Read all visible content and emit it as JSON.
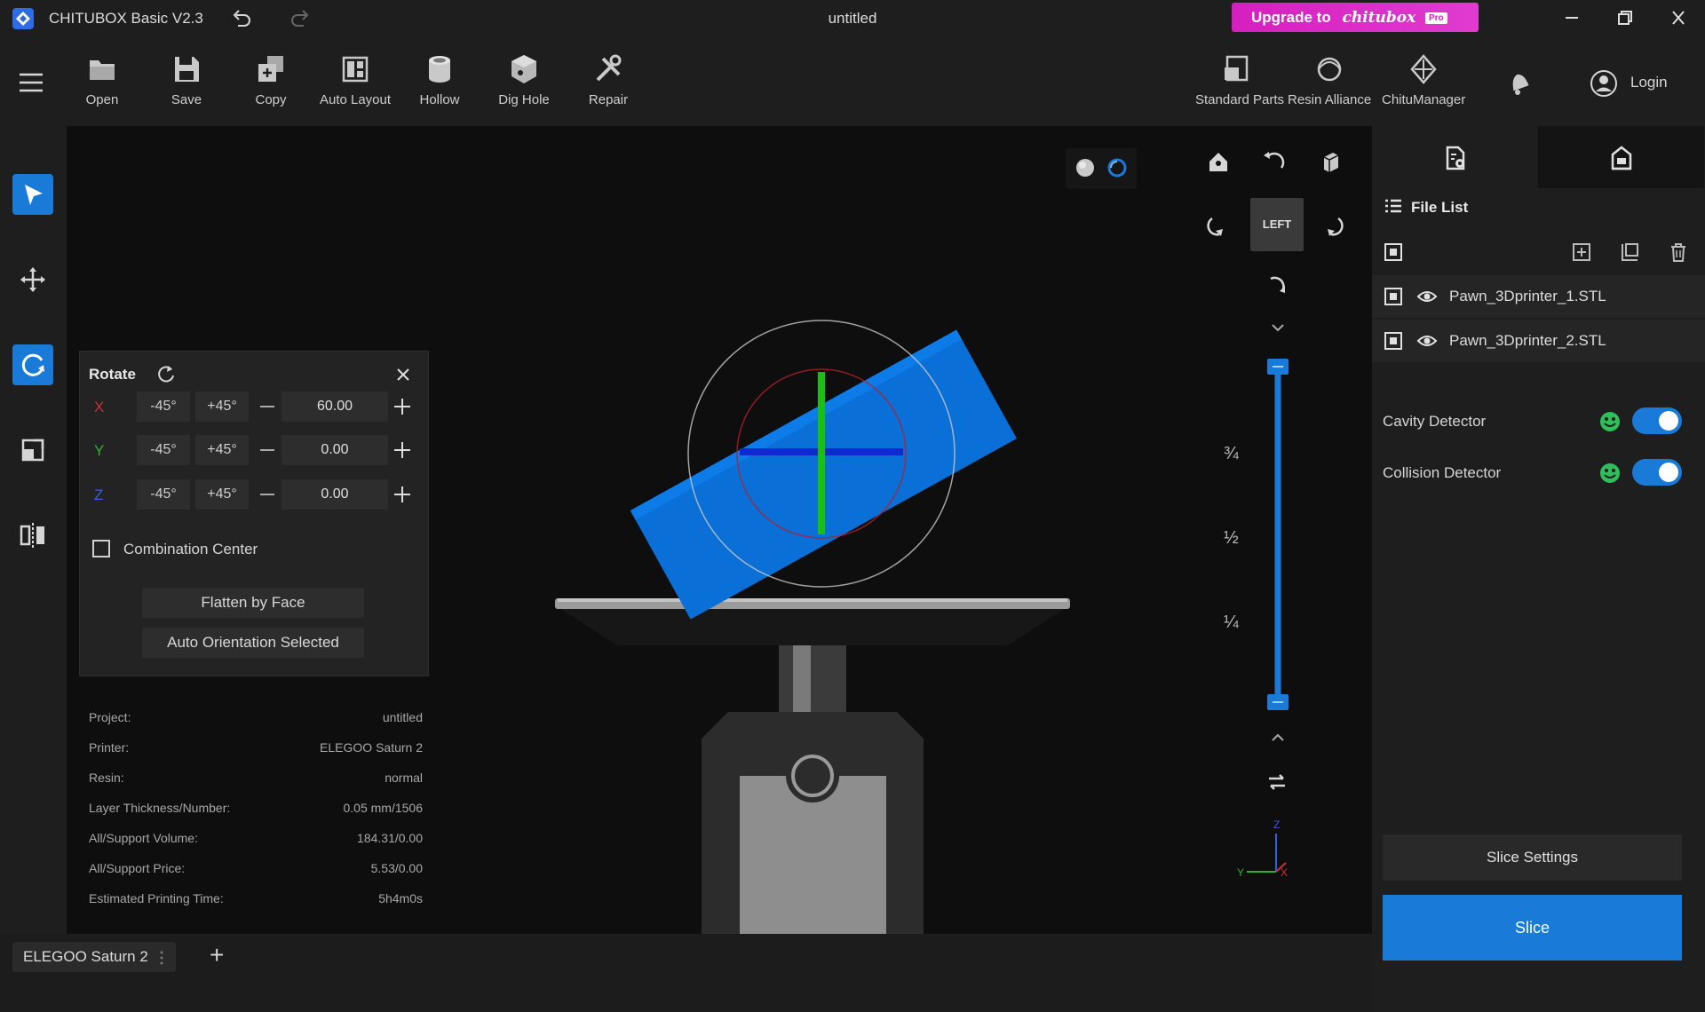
{
  "app": {
    "name": "CHITUBOX Basic V2.3",
    "document_title": "untitled"
  },
  "upgrade": {
    "prefix": "Upgrade to",
    "brand": "chitubox",
    "badge": "Pro"
  },
  "toolbar": {
    "items": [
      {
        "label": "Open",
        "icon": "folder-icon"
      },
      {
        "label": "Save",
        "icon": "save-icon"
      },
      {
        "label": "Copy",
        "icon": "copy-icon"
      },
      {
        "label": "Auto Layout",
        "icon": "auto-layout-icon"
      },
      {
        "label": "Hollow",
        "icon": "hollow-icon"
      },
      {
        "label": "Dig Hole",
        "icon": "dig-hole-icon"
      },
      {
        "label": "Repair",
        "icon": "repair-icon"
      }
    ],
    "right_items": [
      {
        "label": "Standard Parts",
        "icon": "standard-parts-icon"
      },
      {
        "label": "Resin Alliance",
        "icon": "resin-alliance-icon"
      },
      {
        "label": "ChituManager",
        "icon": "chitumanager-icon"
      }
    ],
    "login_label": "Login"
  },
  "rotate": {
    "title": "Rotate",
    "axes": [
      {
        "axis": "X",
        "minus": "-45°",
        "plus": "+45°",
        "value": "60.00",
        "color": "#c8313a"
      },
      {
        "axis": "Y",
        "minus": "-45°",
        "plus": "+45°",
        "value": "0.00",
        "color": "#2fae3a"
      },
      {
        "axis": "Z",
        "minus": "-45°",
        "plus": "+45°",
        "value": "0.00",
        "color": "#3a5ee0"
      }
    ],
    "combination_center": "Combination Center",
    "flatten_by_face": "Flatten by Face",
    "auto_orientation": "Auto Orientation Selected"
  },
  "info": [
    {
      "key": "Project:",
      "value": "untitled"
    },
    {
      "key": "Printer:",
      "value": "ELEGOO Saturn 2"
    },
    {
      "key": "Resin:",
      "value": "normal"
    },
    {
      "key": "Layer Thickness/Number:",
      "value": "0.05 mm/1506"
    },
    {
      "key": "All/Support Volume:",
      "value": "184.31/0.00"
    },
    {
      "key": "All/Support Price:",
      "value": "5.53/0.00"
    },
    {
      "key": "Estimated Printing Time:",
      "value": "5h4m0s"
    }
  ],
  "view": {
    "cube_label": "LEFT",
    "fractions": [
      "3/4",
      "1/2",
      "1/4"
    ],
    "axes_gizmo": {
      "z": "Z",
      "y": "Y",
      "x": "X"
    },
    "slider_range": {
      "top": 1.0,
      "bottom": 0.0
    }
  },
  "bottom_tab": {
    "printer": "ELEGOO Saturn 2",
    "add": "+"
  },
  "right_panel": {
    "file_list_title": "File List",
    "files": [
      "Pawn_3Dprinter_1.STL",
      "Pawn_3Dprinter_2.STL"
    ],
    "detectors": [
      {
        "label": "Cavity Detector",
        "enabled": true
      },
      {
        "label": "Collision Detector",
        "enabled": true
      }
    ],
    "slice_settings": "Slice Settings",
    "slice": "Slice"
  },
  "colors": {
    "accent": "#1a7ad8",
    "brand_pink": "#d61fc0",
    "model_blue": "#0a6fd6"
  }
}
